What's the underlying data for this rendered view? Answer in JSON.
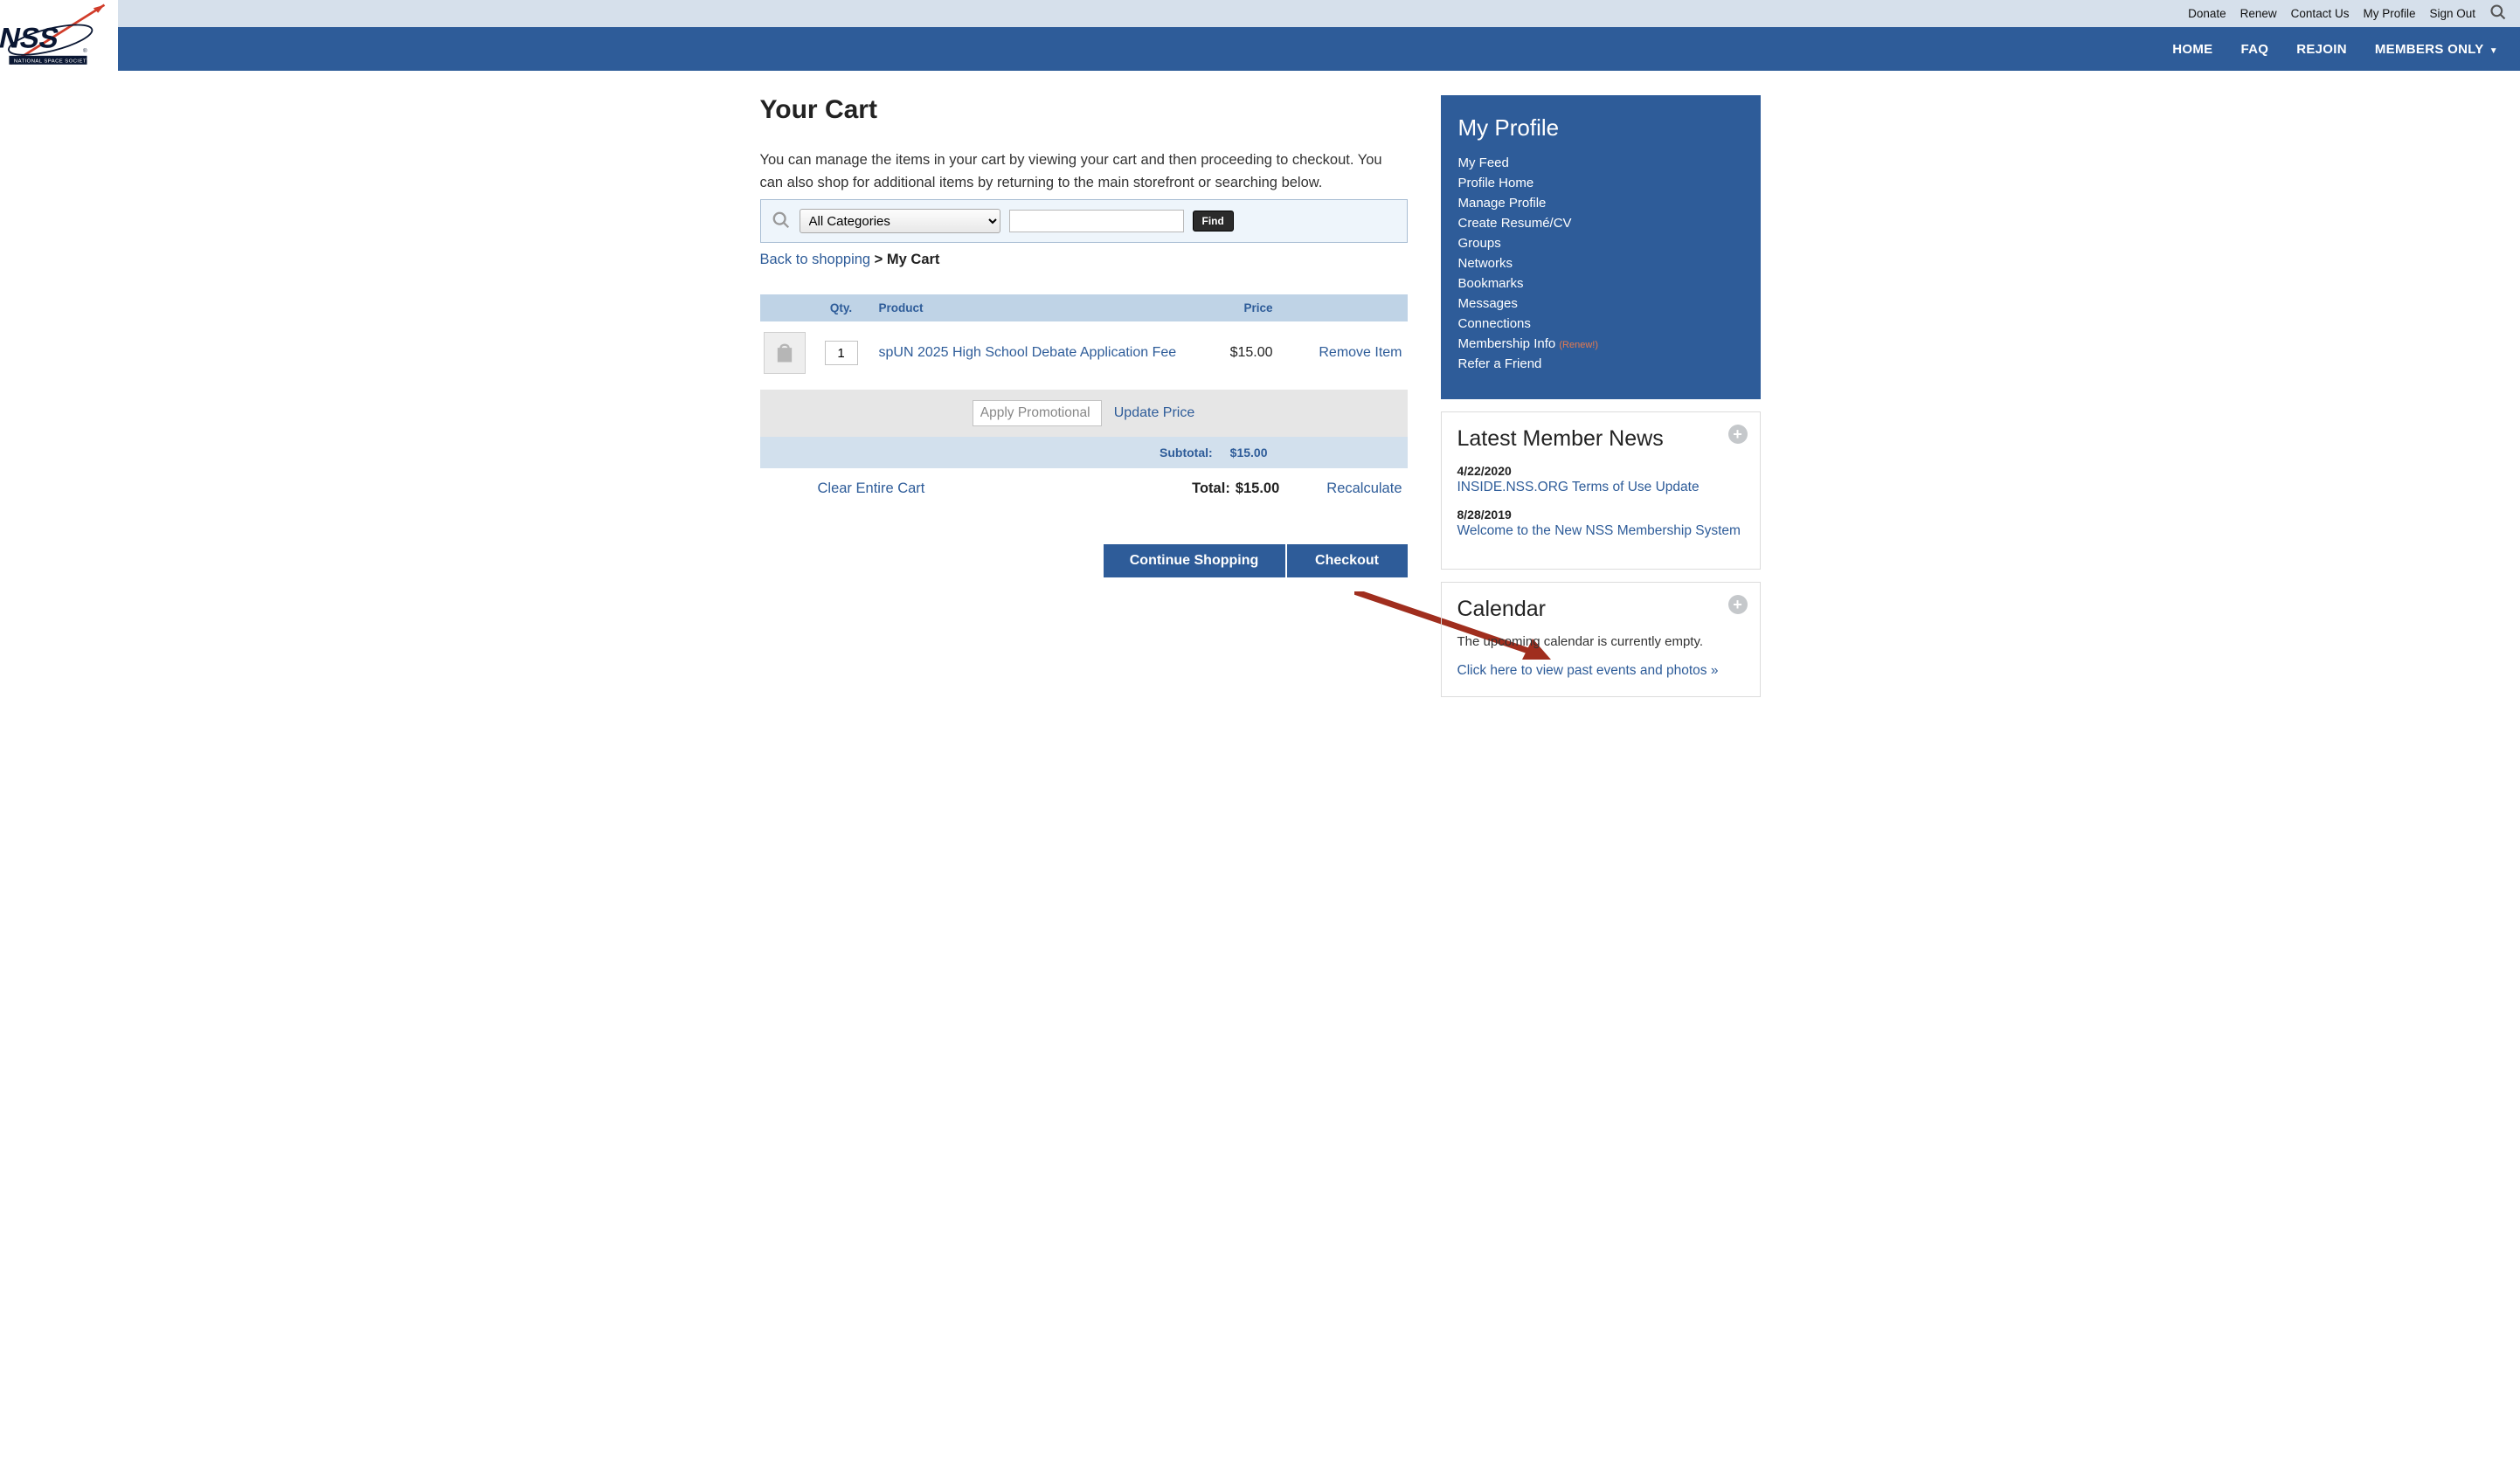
{
  "topnav": {
    "donate": "Donate",
    "renew": "Renew",
    "contact": "Contact Us",
    "profile": "My Profile",
    "signout": "Sign Out"
  },
  "mainnav": {
    "home": "HOME",
    "faq": "FAQ",
    "rejoin": "REJOIN",
    "members": "MEMBERS ONLY"
  },
  "page": {
    "title": "Your Cart",
    "description": "You can manage the items in your cart by viewing your cart and then proceeding to checkout. You can also shop for additional items by returning to the main storefront or searching below."
  },
  "search": {
    "category": "All Categories",
    "find": "Find"
  },
  "breadcrumb": {
    "back": "Back to shopping",
    "sep": " > ",
    "current": "My Cart"
  },
  "cart": {
    "headers": {
      "qty": "Qty.",
      "product": "Product",
      "price": "Price"
    },
    "item": {
      "qty": "1",
      "name": "spUN 2025 High School Debate Application Fee",
      "price": "$15.00",
      "remove": "Remove Item"
    },
    "promo_placeholder": "Apply Promotional Code",
    "update_price": "Update Price",
    "subtotal_label": "Subtotal:",
    "subtotal_value": "$15.00",
    "clear": "Clear Entire Cart",
    "total_label": "Total:",
    "total_value": "$15.00",
    "recalc": "Recalculate",
    "continue": "Continue Shopping",
    "checkout": "Checkout"
  },
  "profile": {
    "title": "My Profile",
    "links": {
      "feed": "My Feed",
      "home": "Profile Home",
      "manage": "Manage Profile",
      "resume": "Create Resumé/CV",
      "groups": "Groups",
      "networks": "Networks",
      "bookmarks": "Bookmarks",
      "messages": "Messages",
      "connections": "Connections",
      "membership": "Membership Info",
      "renew_tag": "(Renew!)",
      "refer": "Refer a Friend"
    }
  },
  "news": {
    "title": "Latest Member News",
    "items": [
      {
        "date": "4/22/2020",
        "title": "INSIDE.NSS.ORG Terms of Use Update"
      },
      {
        "date": "8/28/2019",
        "title": "Welcome to the New NSS Membership System"
      }
    ]
  },
  "calendar": {
    "title": "Calendar",
    "empty": "The upcoming calendar is currently empty.",
    "past_link": "Click here to view past events and photos »"
  }
}
